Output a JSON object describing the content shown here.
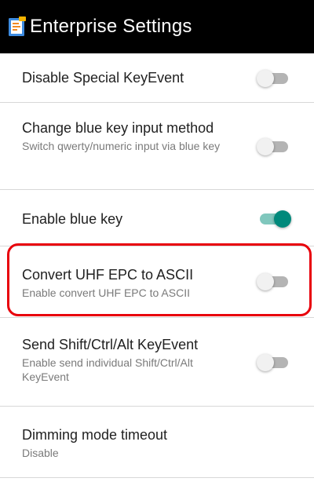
{
  "app": {
    "title": "Enterprise Settings",
    "icon": "settings-app-icon"
  },
  "settings": [
    {
      "label": "Disable Special KeyEvent",
      "summary": "",
      "checked": false
    },
    {
      "label": "Change blue key input method",
      "summary": "Switch qwerty/numeric input via blue key",
      "checked": false
    },
    {
      "label": "Enable blue key",
      "summary": "",
      "checked": true
    },
    {
      "label": "Convert UHF EPC to ASCII",
      "summary": "Enable convert UHF EPC to ASCII",
      "checked": false
    },
    {
      "label": "Send Shift/Ctrl/Alt KeyEvent",
      "summary": "Enable send individual Shift/Ctrl/Alt KeyEvent",
      "checked": false
    },
    {
      "label": "Dimming mode timeout",
      "summary": "Disable",
      "checked": null
    }
  ],
  "colors": {
    "accent": "#00897b",
    "accent_track": "#80c7bd",
    "highlight": "#e8000b",
    "titlebar": "#000000"
  }
}
